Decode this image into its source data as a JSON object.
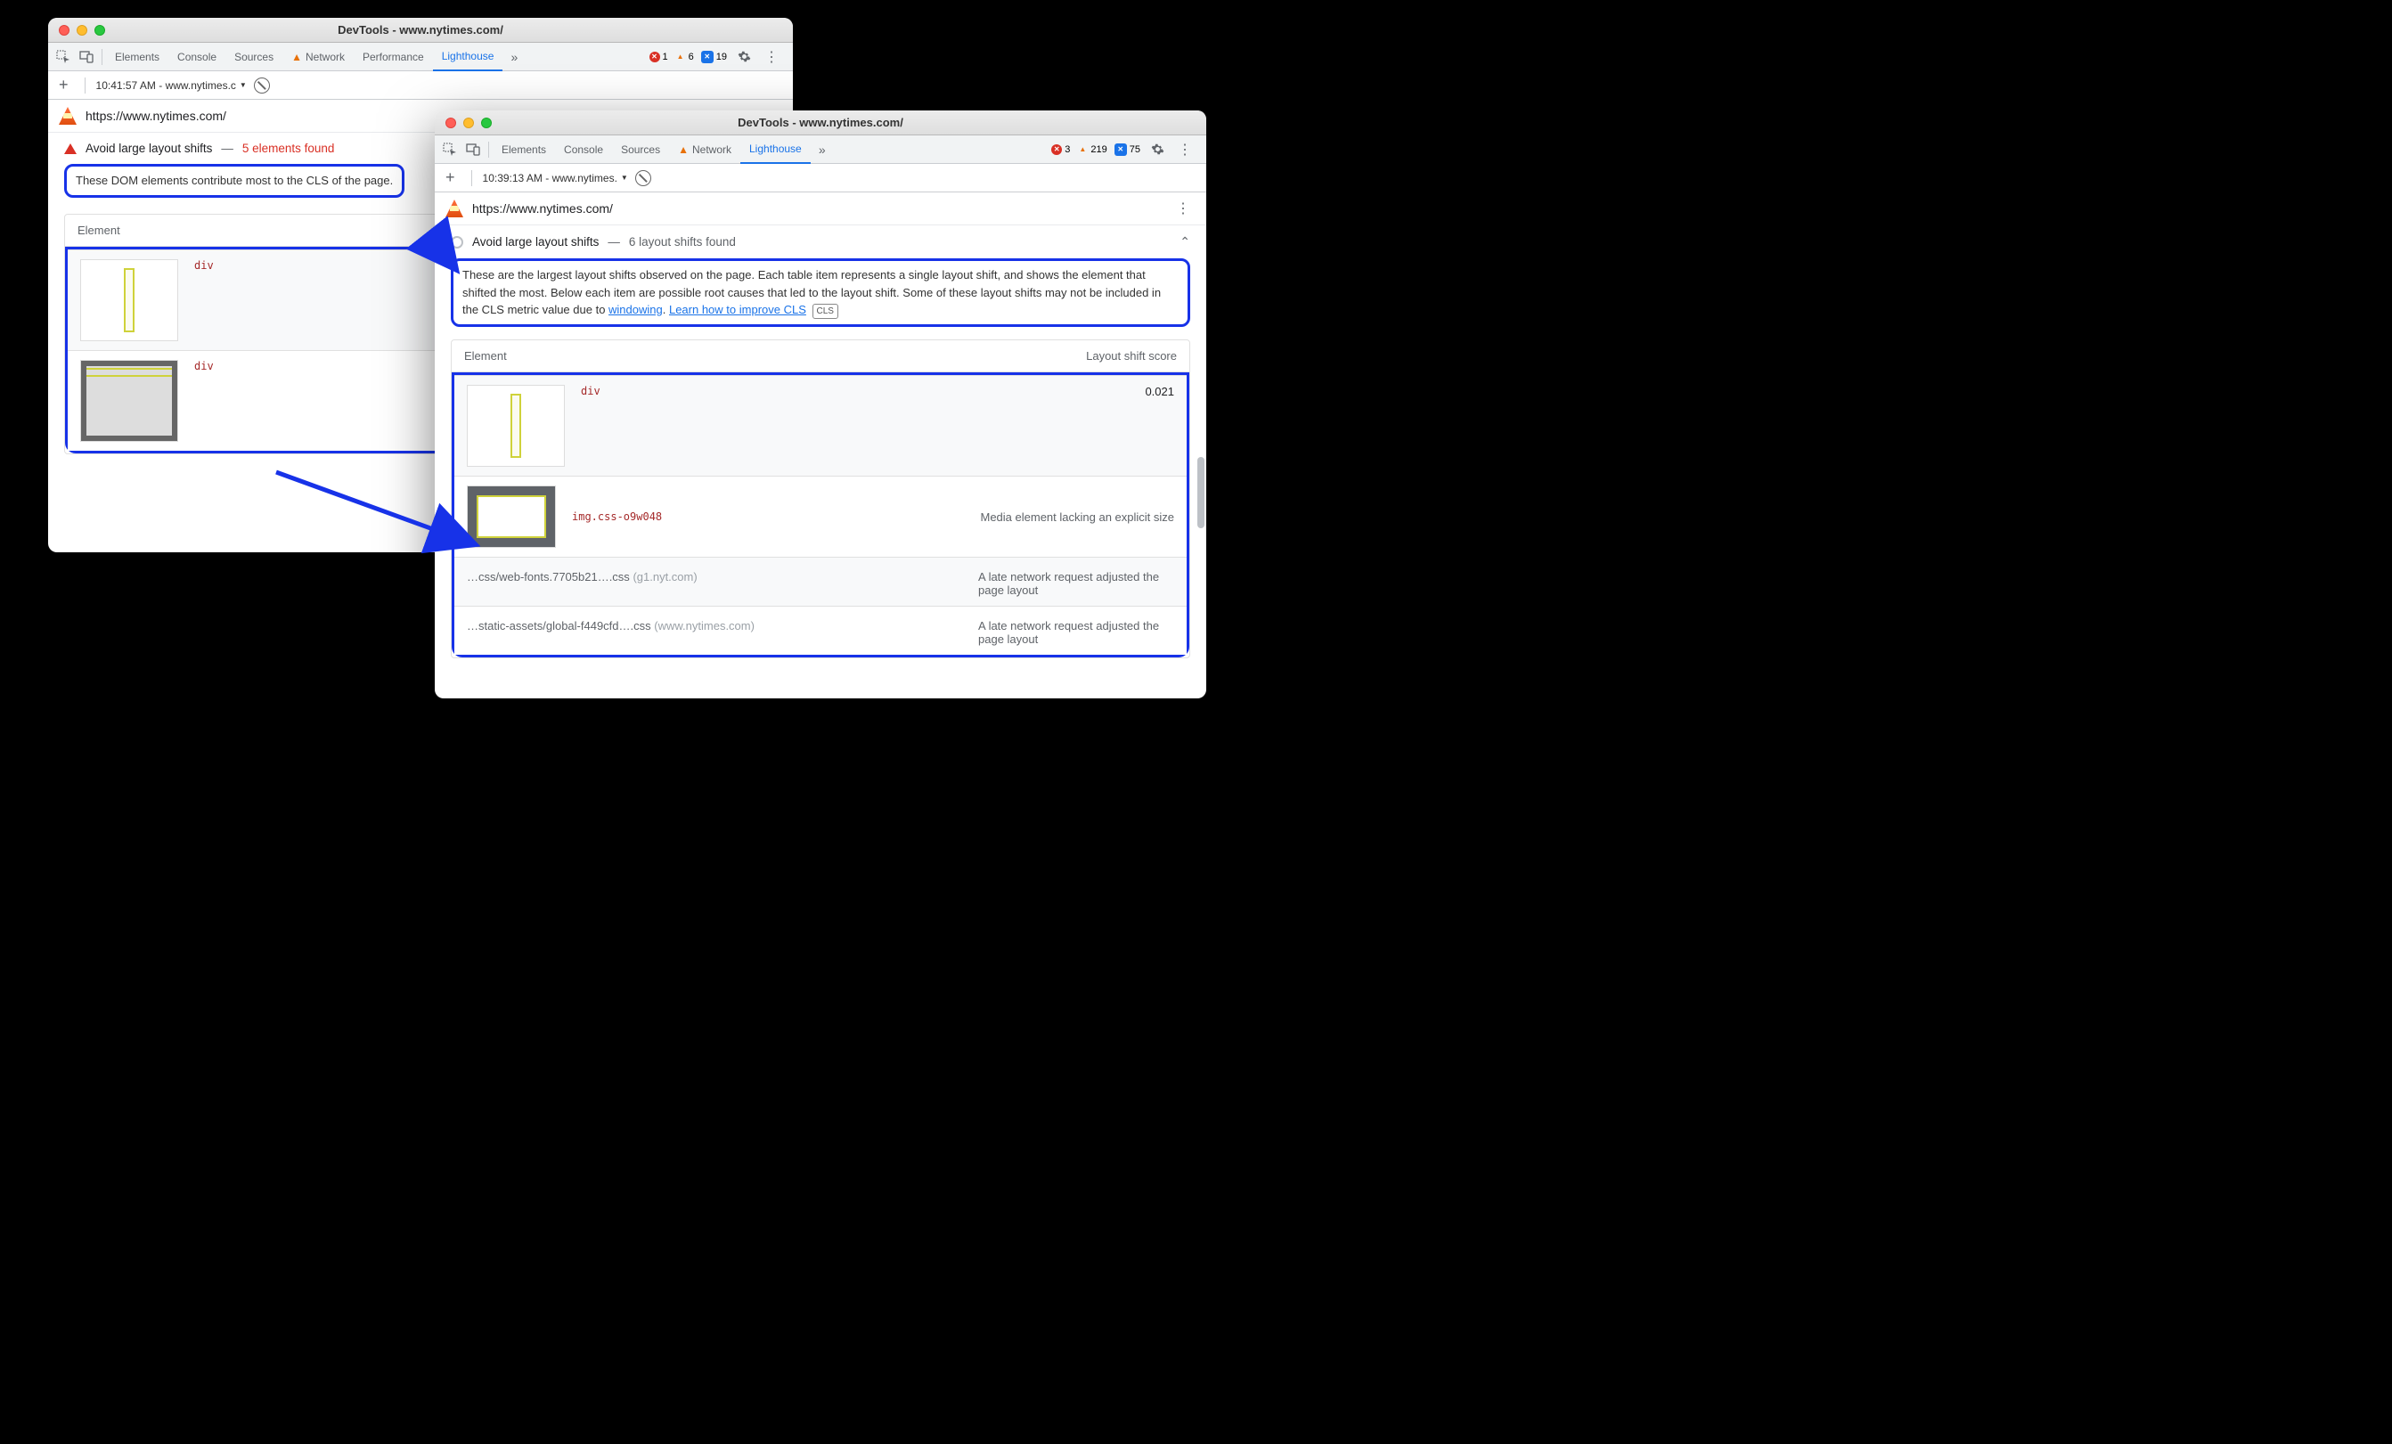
{
  "left_window": {
    "title": "DevTools - www.nytimes.com/",
    "tabs": [
      "Elements",
      "Console",
      "Sources",
      "Network",
      "Performance",
      "Lighthouse"
    ],
    "active_tab": "Lighthouse",
    "counts": {
      "errors": "1",
      "warnings": "6",
      "issues": "19"
    },
    "sub_dropdown": "10:41:57 AM - www.nytimes.c",
    "url": "https://www.nytimes.com/",
    "audit_title": "Avoid large layout shifts",
    "audit_count": "5 elements found",
    "callout_text": "These DOM elements contribute most to the CLS of the page.",
    "table_header": "Element",
    "rows": [
      {
        "code": "div"
      },
      {
        "code": "div"
      }
    ]
  },
  "right_window": {
    "title": "DevTools - www.nytimes.com/",
    "tabs": [
      "Elements",
      "Console",
      "Sources",
      "Network",
      "Lighthouse"
    ],
    "active_tab": "Lighthouse",
    "counts": {
      "errors": "3",
      "warnings": "219",
      "issues": "75"
    },
    "sub_dropdown": "10:39:13 AM - www.nytimes.",
    "url": "https://www.nytimes.com/",
    "audit_title": "Avoid large layout shifts",
    "audit_count": "6 layout shifts found",
    "callout_text_1": "These are the largest layout shifts observed on the page. Each table item represents a single layout shift, and shows the element that shifted the most. Below each item are possible root causes that led to the layout shift. Some of these layout shifts may not be included in the CLS metric value due to ",
    "callout_link_1": "windowing",
    "callout_sep": ". ",
    "callout_link_2": "Learn how to improve CLS",
    "callout_chip": "CLS",
    "table_header_left": "Element",
    "table_header_right": "Layout shift score",
    "row1_code": "div",
    "row1_score": "0.021",
    "row2_code": "img.css-o9w048",
    "row2_cause": "Media element lacking an explicit size",
    "cause3_left": "…css/web-fonts.7705b21….css",
    "cause3_origin": "(g1.nyt.com)",
    "cause3_right": "A late network request adjusted the page layout",
    "cause4_left": "…static-assets/global-f449cfd….css",
    "cause4_origin": "(www.nytimes.com)",
    "cause4_right": "A late network request adjusted the page layout"
  }
}
